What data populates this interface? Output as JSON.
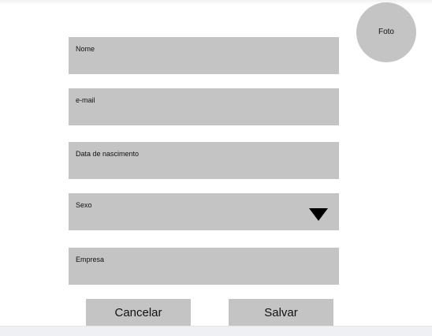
{
  "photo": {
    "label": "Foto"
  },
  "form": {
    "fields": {
      "name": {
        "label": "Nome"
      },
      "email": {
        "label": "e-mail"
      },
      "birthdate": {
        "label": "Data de nascimento"
      },
      "sex": {
        "label": "Sexo",
        "icon": "triangle-down-icon"
      },
      "company": {
        "label": "Empresa"
      }
    }
  },
  "actions": {
    "cancel_label": "Cancelar",
    "save_label": "Salvar"
  },
  "colors": {
    "field_bg": "#c4c4c4",
    "text": "#111111",
    "page_bg": "#ffffff",
    "arrow": "#000000"
  }
}
